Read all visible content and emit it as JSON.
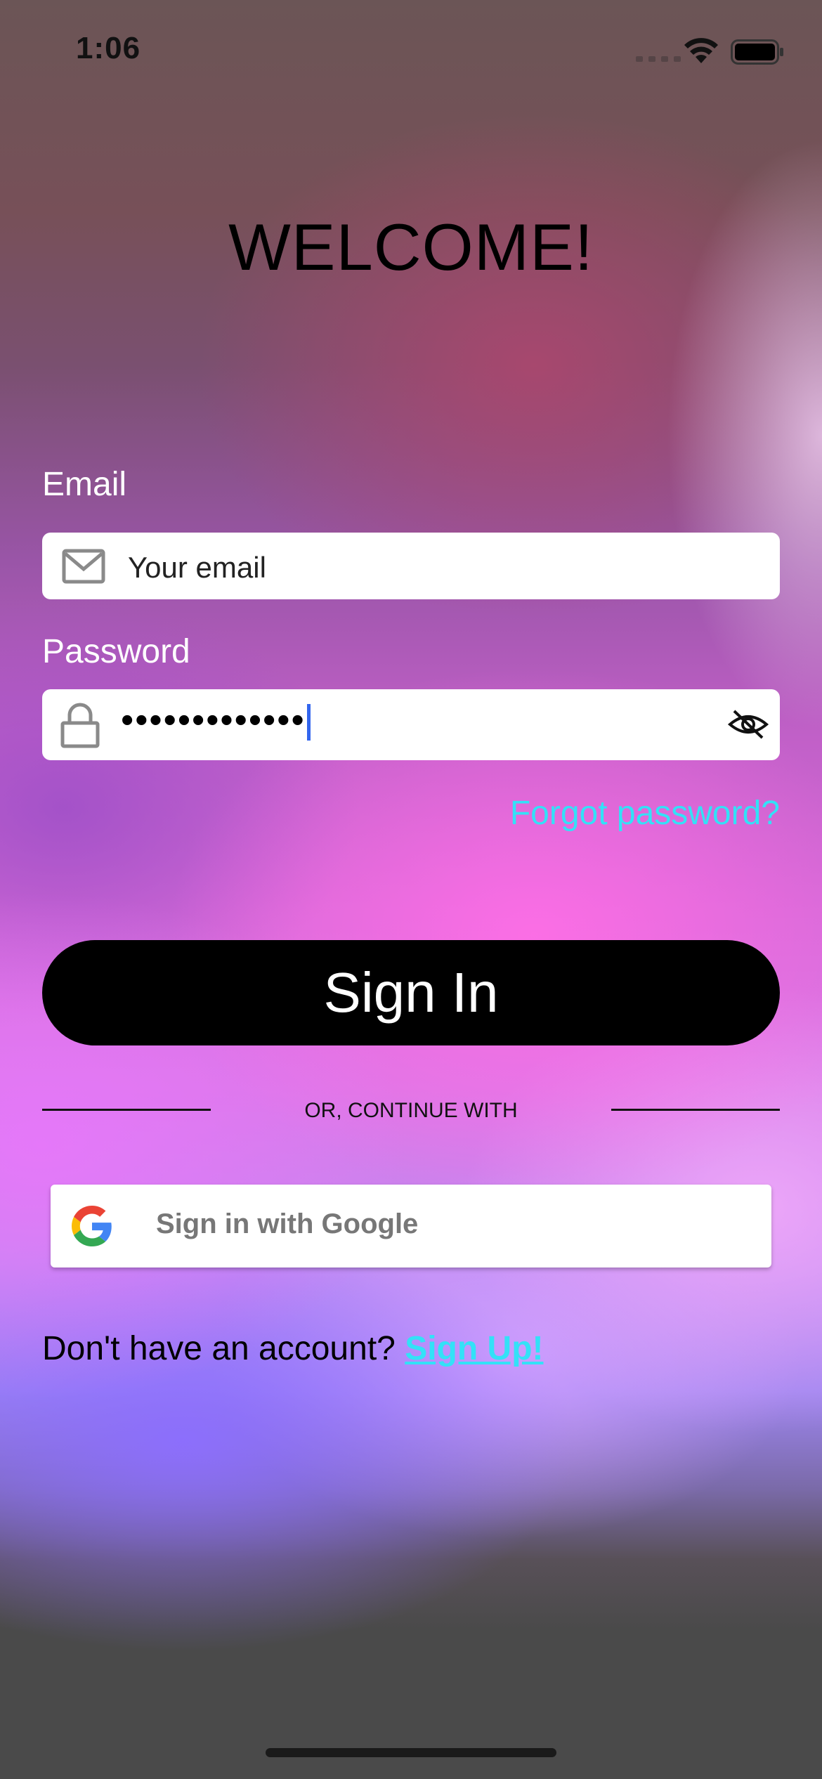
{
  "status_bar": {
    "time": "1:06"
  },
  "title": "WELCOME!",
  "email": {
    "label": "Email",
    "placeholder": "Your email",
    "icon": "mail-icon"
  },
  "password": {
    "label": "Password",
    "value": "•••••••••••••",
    "icon": "lock-icon",
    "toggle_icon": "eye-off-icon"
  },
  "forgot_password": "Forgot password?",
  "sign_in_button": "Sign In",
  "divider_text": "OR, CONTINUE WITH",
  "google_button": {
    "label": "Sign in with Google",
    "icon": "google-logo-icon"
  },
  "signup": {
    "prompt": "Don't have an account?",
    "link": "Sign Up!"
  },
  "colors": {
    "accent_link": "#33e1f7",
    "button_bg": "#000000",
    "button_text": "#ffffff"
  }
}
